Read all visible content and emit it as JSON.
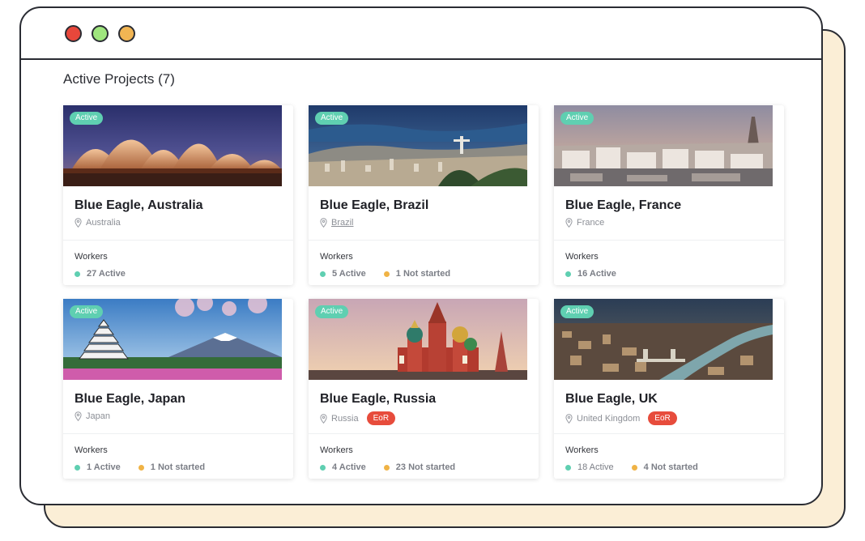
{
  "page": {
    "title": "Active Projects (7)"
  },
  "colors": {
    "active": "#5fcfb1",
    "not_started": "#f0b345",
    "eor": "#e74c3c"
  },
  "common": {
    "workers_label": "Workers"
  },
  "projects": [
    {
      "name": "Blue Eagle, Australia",
      "status": "Active",
      "location": "Australia",
      "eor": "",
      "active": "27 Active",
      "not_started": ""
    },
    {
      "name": "Blue Eagle, Brazil",
      "status": "Active",
      "location": "Brazil",
      "eor": "",
      "active": "5 Active",
      "not_started": "1 Not started"
    },
    {
      "name": "Blue Eagle, France",
      "status": "Active",
      "location": "France",
      "eor": "",
      "active": "16 Active",
      "not_started": ""
    },
    {
      "name": "Blue Eagle, Japan",
      "status": "Active",
      "location": "Japan",
      "eor": "",
      "active": "1 Active",
      "not_started": "1 Not started"
    },
    {
      "name": "Blue Eagle, Russia",
      "status": "Active",
      "location": "Russia",
      "eor": "EoR",
      "active": "4 Active",
      "not_started": "23 Not started"
    },
    {
      "name": "Blue Eagle, UK",
      "status": "Active",
      "location": "United Kingdom",
      "eor": "EoR",
      "active": "18 Active",
      "not_started": "4 Not started"
    }
  ]
}
